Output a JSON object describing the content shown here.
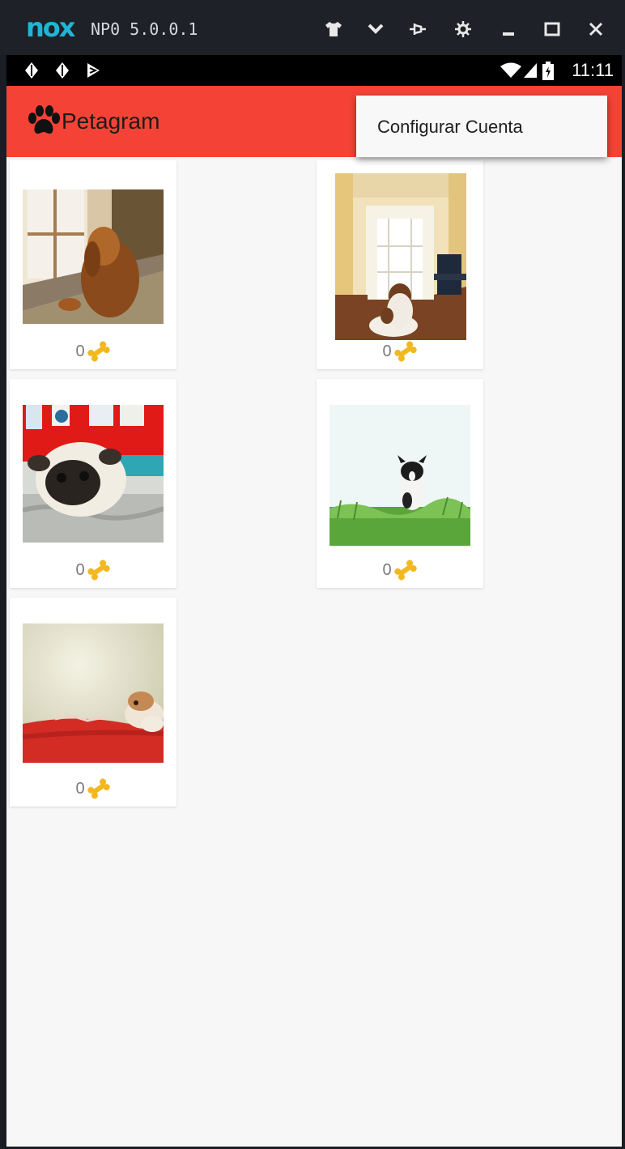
{
  "emulator": {
    "logo": "nox",
    "version": "NP0 5.0.0.1"
  },
  "statusbar": {
    "time": "11:11"
  },
  "app": {
    "title": "Petagram",
    "accent": "#f44336"
  },
  "menu": {
    "items": [
      {
        "label": "Configurar Cuenta"
      }
    ]
  },
  "pets": [
    {
      "likes": "0",
      "photo": "dog looking out window"
    },
    {
      "likes": "0",
      "photo": "dog lying in hallway"
    },
    {
      "likes": "0",
      "photo": "pug lying on rug"
    },
    {
      "likes": "0",
      "photo": "dog sitting on grass"
    },
    {
      "likes": "0",
      "photo": "dog lying on red blanket"
    }
  ]
}
